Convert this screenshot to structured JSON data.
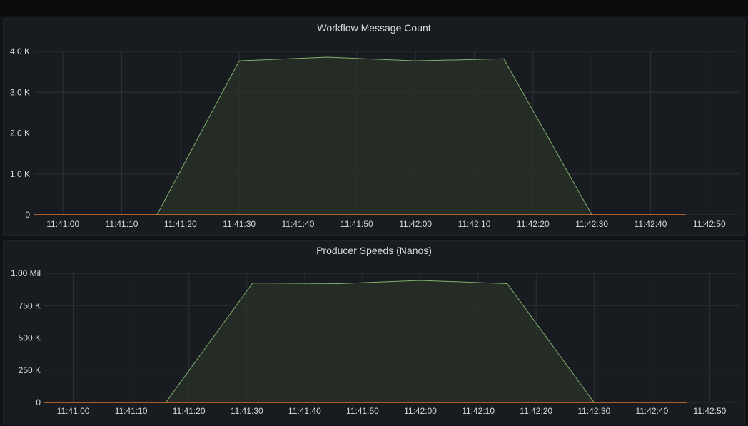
{
  "colors": {
    "background": "#111217",
    "panel": "#181b1f",
    "grid": "#2c2f34",
    "series_line": "#7eb26d",
    "series_fill": "#2a3328",
    "baseline": "#e0752d",
    "text": "#d8d9da"
  },
  "panels": [
    {
      "title": "Workflow Message Count"
    },
    {
      "title": "Producer Speeds (Nanos)"
    }
  ],
  "chart_data": [
    {
      "type": "area",
      "title": "Workflow Message Count",
      "xlabel": "",
      "ylabel": "",
      "x_ticks": [
        "11:41:00",
        "11:41:10",
        "11:41:20",
        "11:41:30",
        "11:41:40",
        "11:41:50",
        "11:42:00",
        "11:42:10",
        "11:42:20",
        "11:42:30",
        "11:42:40",
        "11:42:50"
      ],
      "y_ticks": [
        "0",
        "1.0 K",
        "2.0 K",
        "3.0 K",
        "4.0 K"
      ],
      "ylim": [
        0,
        4000
      ],
      "xlim": [
        "11:40:55",
        "11:42:55"
      ],
      "grid": true,
      "series": [
        {
          "x": [
            "11:40:55",
            "11:41:16",
            "11:41:30",
            "11:41:45",
            "11:42:00",
            "11:42:15",
            "11:42:30",
            "11:42:46"
          ],
          "values": [
            0,
            0,
            3770,
            3860,
            3770,
            3820,
            0,
            0
          ]
        },
        {
          "x": [
            "11:40:55",
            "11:42:46"
          ],
          "values": [
            0,
            0
          ]
        }
      ]
    },
    {
      "type": "area",
      "title": "Producer Speeds (Nanos)",
      "xlabel": "",
      "ylabel": "",
      "x_ticks": [
        "11:41:00",
        "11:41:10",
        "11:41:20",
        "11:41:30",
        "11:41:40",
        "11:41:50",
        "11:42:00",
        "11:42:10",
        "11:42:20",
        "11:42:30",
        "11:42:40",
        "11:42:50"
      ],
      "y_ticks": [
        "0",
        "250 K",
        "500 K",
        "750 K",
        "1.00 Mil"
      ],
      "ylim": [
        0,
        1000000
      ],
      "xlim": [
        "11:40:55",
        "11:42:55"
      ],
      "grid": true,
      "series": [
        {
          "x": [
            "11:40:55",
            "11:41:16",
            "11:41:31",
            "11:41:46",
            "11:42:00",
            "11:42:15",
            "11:42:30",
            "11:42:46"
          ],
          "values": [
            0,
            0,
            925000,
            920000,
            945000,
            920000,
            0,
            0
          ]
        },
        {
          "x": [
            "11:40:55",
            "11:42:46"
          ],
          "values": [
            0,
            0
          ]
        }
      ]
    }
  ]
}
